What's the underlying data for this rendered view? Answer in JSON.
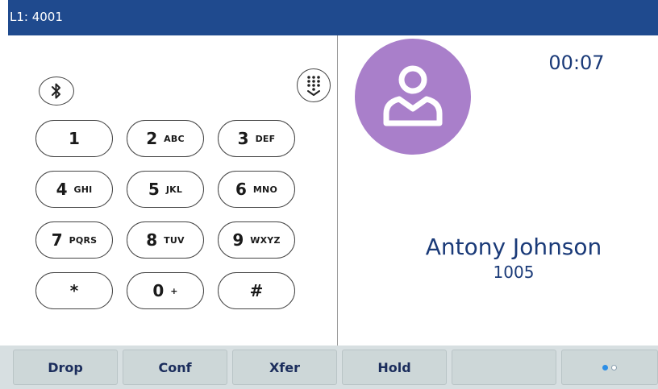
{
  "header": {
    "line_label": "L1: 4001"
  },
  "dialpad": {
    "keys": [
      {
        "digit": "1",
        "letters": ""
      },
      {
        "digit": "2",
        "letters": "ABC"
      },
      {
        "digit": "3",
        "letters": "DEF"
      },
      {
        "digit": "4",
        "letters": "GHI"
      },
      {
        "digit": "5",
        "letters": "JKL"
      },
      {
        "digit": "6",
        "letters": "MNO"
      },
      {
        "digit": "7",
        "letters": "PQRS"
      },
      {
        "digit": "8",
        "letters": "TUV"
      },
      {
        "digit": "9",
        "letters": "WXYZ"
      },
      {
        "digit": "*",
        "letters": ""
      },
      {
        "digit": "0",
        "letters": "+"
      },
      {
        "digit": "#",
        "letters": ""
      }
    ]
  },
  "call": {
    "timer": "00:07",
    "caller_name": "Antony Johnson",
    "caller_number": "1005",
    "avatar_color": "#a97fca"
  },
  "softkeys": [
    {
      "label": "Drop"
    },
    {
      "label": "Conf"
    },
    {
      "label": "Xfer"
    },
    {
      "label": "Hold"
    },
    {
      "label": ""
    }
  ],
  "pager": {
    "total": 2,
    "current": 1
  },
  "icons": {
    "bluetooth": "bluetooth-icon",
    "collapse_keypad": "keypad-collapse-icon",
    "avatar": "person-icon"
  },
  "colors": {
    "header_bg": "#1f4a8e",
    "text_accent": "#1a3a78",
    "softkey_bg": "#cdd7d8",
    "pager_active": "#2c8ee6"
  }
}
